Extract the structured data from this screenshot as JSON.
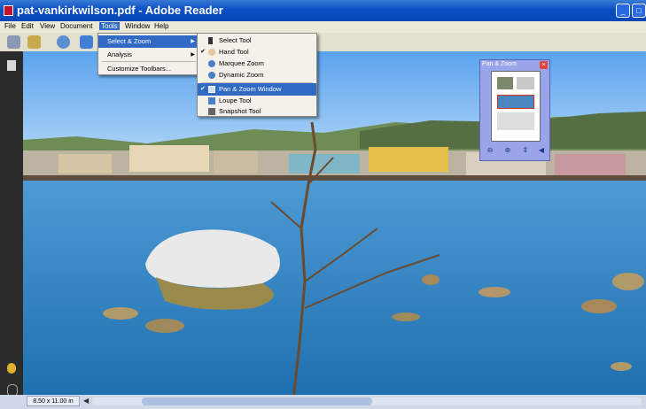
{
  "window": {
    "title": "pat-vankirkwilson.pdf - Adobe Reader"
  },
  "menubar": {
    "items": [
      "File",
      "Edit",
      "View",
      "Document",
      "Tools",
      "Window",
      "Help"
    ],
    "active": "Tools"
  },
  "tools_menu": {
    "items": [
      {
        "label": "Select & Zoom",
        "submenu": true
      },
      {
        "label": "Analysis",
        "submenu": true
      },
      {
        "label": "Customize Toolbars..."
      }
    ]
  },
  "select_zoom_submenu": {
    "items": [
      {
        "label": "Select Tool",
        "icon": "cursor-arrow-icon",
        "checked": false
      },
      {
        "label": "Hand Tool",
        "icon": "hand-icon",
        "checked": true
      },
      {
        "label": "Marquee Zoom",
        "icon": "marquee-zoom-icon",
        "checked": false
      },
      {
        "label": "Dynamic Zoom",
        "icon": "dynamic-zoom-icon",
        "checked": false
      },
      {
        "label": "Pan & Zoom Window",
        "icon": "pan-zoom-window-icon",
        "checked": true,
        "highlighted": true
      },
      {
        "label": "Loupe Tool",
        "icon": "loupe-icon",
        "checked": false
      },
      {
        "label": "Snapshot Tool",
        "icon": "camera-icon",
        "checked": false
      }
    ]
  },
  "pan_zoom_window": {
    "title": "Pan & Zoom",
    "controls": [
      "zoom-out-icon",
      "zoom-in-icon",
      "fit-page-icon",
      "back-icon"
    ]
  },
  "statusbar": {
    "page_size": "8.50 x 11.00 in"
  },
  "colors": {
    "titlebar": "#0a4fc4",
    "menu_highlight": "#316ac5",
    "panzoom_bg": "#9aa4e8",
    "sky": "#6fb2f0",
    "water": "#2f84c2"
  }
}
